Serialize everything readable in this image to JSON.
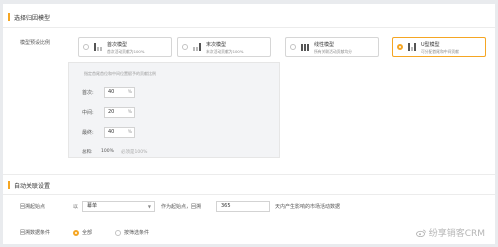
{
  "attribution_section": {
    "title": "选择归因模型",
    "ratio_label": "模型预设比例",
    "models": [
      {
        "title": "首次模型",
        "desc": "首次活动贡献为100%",
        "icon": "bar-chart-first-icon",
        "selected": false
      },
      {
        "title": "末次模型",
        "desc": "末次活动贡献为100%",
        "icon": "bar-chart-last-icon",
        "selected": false
      },
      {
        "title": "线性模型",
        "desc": "所有关联活动贡献均分",
        "icon": "bar-chart-linear-icon",
        "selected": false
      },
      {
        "title": "U型模型",
        "desc": "可分配首尾和中间贡献",
        "icon": "u-shape-icon",
        "selected": true
      }
    ],
    "ratio_panel": {
      "hint": "指定首尾首位和中间位置赋予的贡献比例",
      "rows": [
        {
          "label": "首次:",
          "value": "40",
          "unit": "%"
        },
        {
          "label": "中间:",
          "value": "20",
          "unit": "%"
        },
        {
          "label": "最终:",
          "value": "40",
          "unit": "%"
        }
      ],
      "total_label": "总和:",
      "total_value": "100%",
      "total_note": "必须是100%"
    }
  },
  "related_section": {
    "title": "自动关联设置",
    "lookback_label": "回溯起始点",
    "lookback_prefix": "以",
    "lookback_select": "幕单",
    "lookback_middle": "作为起始点，回溯",
    "lookback_days": "365",
    "lookback_suffix": "天内产生影响的市场活动数据",
    "condition_label": "回溯数据条件",
    "conditions": [
      {
        "label": "全部",
        "selected": true
      },
      {
        "label": "按筛选条件",
        "selected": false
      }
    ]
  },
  "watermark": "纷享销客CRM",
  "colors": {
    "accent": "#f5a623",
    "border": "#d3d3d3",
    "panel_bg": "#f3f4f6"
  }
}
